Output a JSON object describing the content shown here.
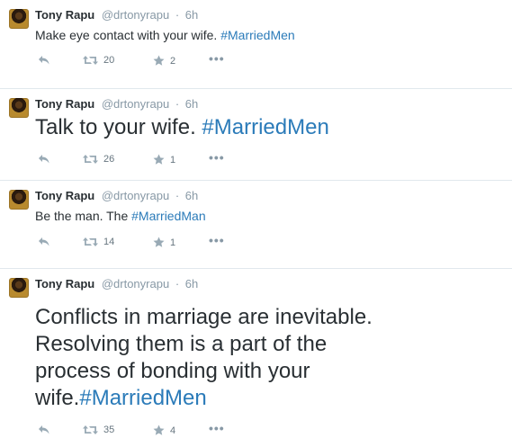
{
  "tweets": [
    {
      "author": {
        "name": "Tony Rapu",
        "handle": "@drtonyrapu"
      },
      "sep": "·",
      "time": "6h",
      "text": "Make eye contact with your wife. ",
      "hashtag": "#MarriedMen",
      "retweets": "20",
      "favorites": "2"
    },
    {
      "author": {
        "name": "Tony Rapu",
        "handle": "@drtonyrapu"
      },
      "sep": "·",
      "time": "6h",
      "text": "Talk to your wife. ",
      "hashtag": "#MarriedMen",
      "retweets": "26",
      "favorites": "1"
    },
    {
      "author": {
        "name": "Tony Rapu",
        "handle": "@drtonyrapu"
      },
      "sep": "·",
      "time": "6h",
      "text": "Be the man. The ",
      "hashtag": "#MarriedMan",
      "retweets": "14",
      "favorites": "1"
    },
    {
      "author": {
        "name": "Tony Rapu",
        "handle": "@drtonyrapu"
      },
      "sep": "·",
      "time": "6h",
      "text_lines": [
        "Conflicts in marriage are inevitable.",
        "Resolving them is a part of the",
        "process of bonding with your",
        "wife."
      ],
      "hashtag": "#MarriedMen",
      "retweets": "35",
      "favorites": "4"
    }
  ],
  "icons": {
    "reply": "reply-icon",
    "retweet": "retweet-icon",
    "favorite": "star-icon",
    "more": "more-icon",
    "more_glyph": "•••"
  },
  "colors": {
    "hashtag": "#2b7bb9",
    "muted": "#8899a6",
    "text": "#292f33",
    "divider": "#e1e8ed"
  }
}
